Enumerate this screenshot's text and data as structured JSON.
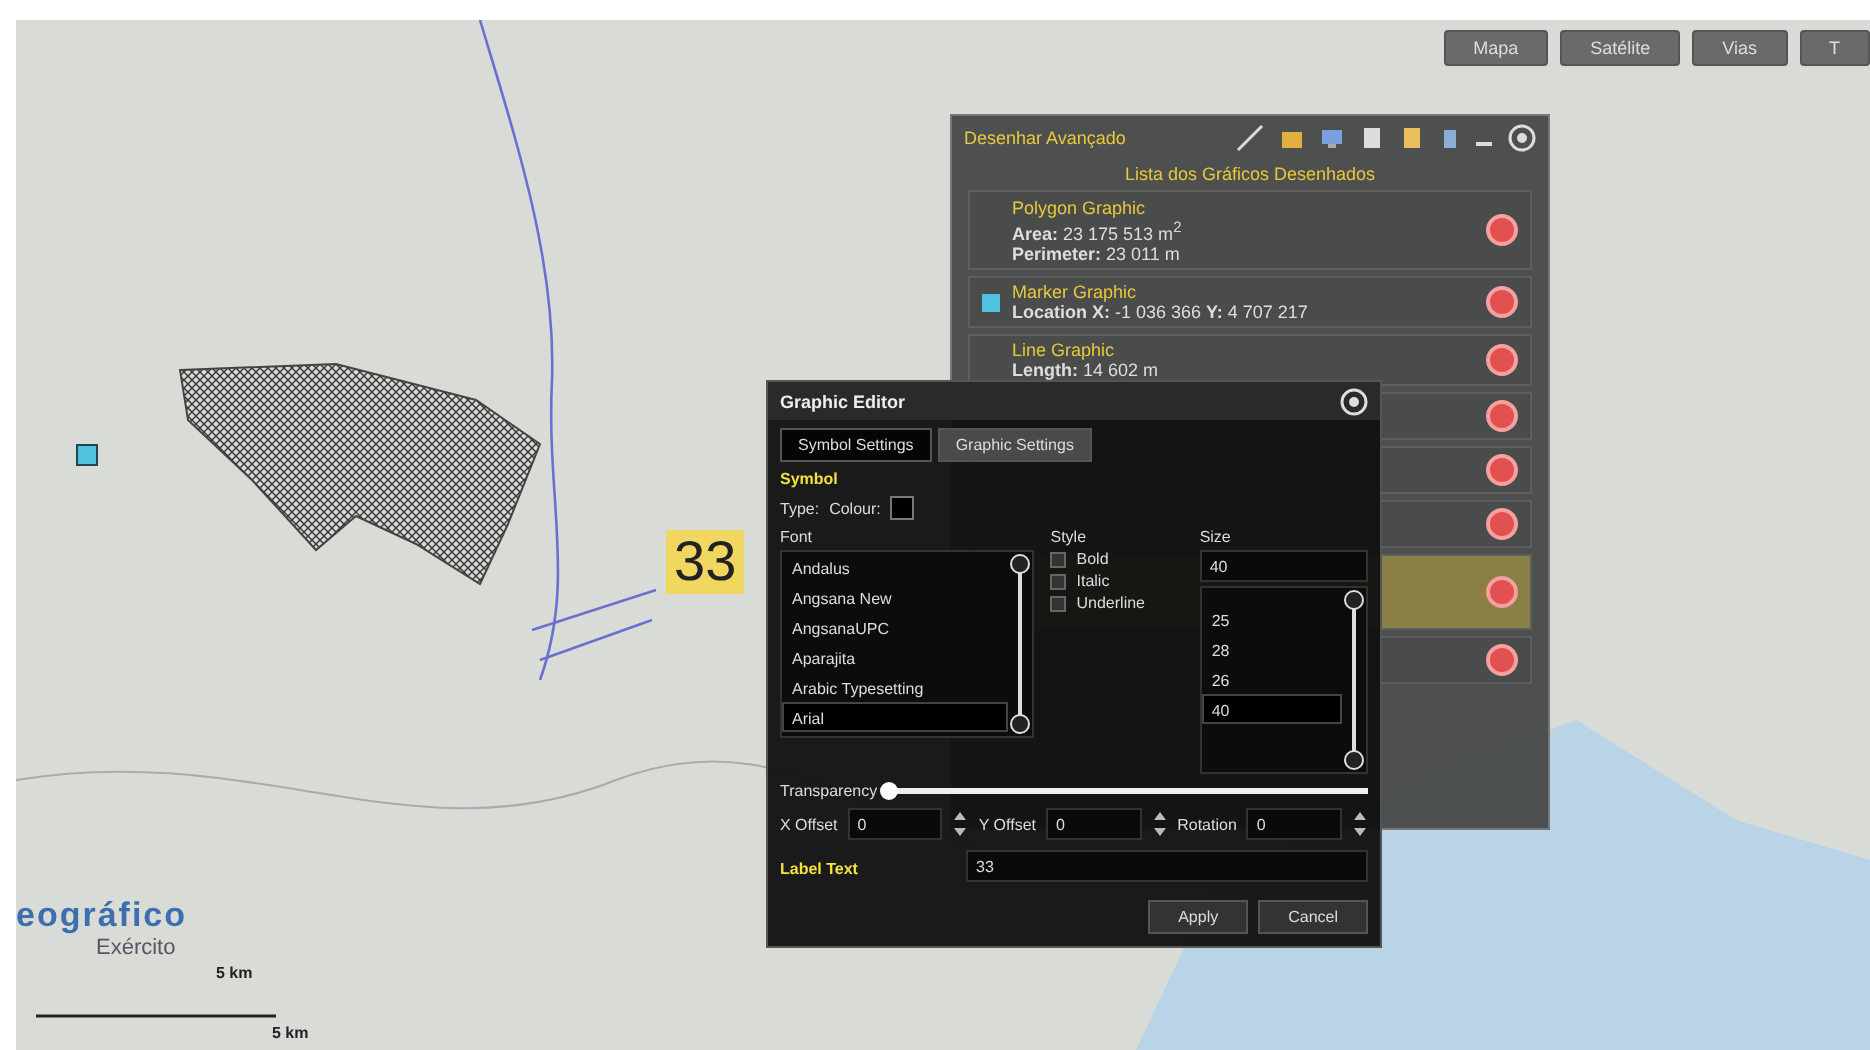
{
  "map_buttons": [
    {
      "label": "Mapa",
      "selected": false
    },
    {
      "label": "Satélite",
      "selected": false
    },
    {
      "label": "Vias",
      "selected": false
    },
    {
      "label": "T",
      "selected": false
    }
  ],
  "map_label": "33",
  "logo": {
    "line_1": "eográfico",
    "line_2": "Exército"
  },
  "scale": {
    "label_top": "5 km",
    "label_end": "5 km"
  },
  "drawn_panel": {
    "title": "Desenhar Avançado",
    "subtitle": "Lista dos Gráficos Desenhados",
    "items": [
      {
        "kind": "polygon",
        "title": "Polygon Graphic",
        "lines": [
          "**Area:** 23 175 513 m$^{2}$",
          "**Perimeter:** 23 011 m"
        ],
        "selected": false
      },
      {
        "kind": "marker",
        "title": "Marker Graphic",
        "color": "#4fc3e0",
        "lines": [
          "**Location X:** -1 036 366 **Y:** 4 707 217"
        ],
        "selected": false
      },
      {
        "kind": "line",
        "title": "Line Graphic",
        "lines": [
          "**Length:** 14 602 m"
        ],
        "selected": false
      },
      {
        "kind": "covered",
        "selected": false
      },
      {
        "kind": "covered",
        "selected": false
      },
      {
        "kind": "covered",
        "selected": false
      },
      {
        "kind": "covered",
        "selected": true
      },
      {
        "kind": "covered",
        "selected": false
      }
    ]
  },
  "graphic_editor": {
    "title": "Graphic Editor",
    "tabs": [
      {
        "label": "Symbol Settings",
        "selected": true
      },
      {
        "label": "Graphic Settings",
        "selected": false
      }
    ],
    "section": "Symbol",
    "type_label": "Type:",
    "colour_label": "Colour:",
    "colour_swatch": {
      "color": "#000000"
    },
    "font": {
      "label": "Font",
      "options": [
        {
          "label": "Andalus",
          "selected": false
        },
        {
          "label": "Angsana New",
          "selected": false
        },
        {
          "label": "AngsanaUPC",
          "selected": false
        },
        {
          "label": "Aparajita",
          "selected": false
        },
        {
          "label": "Arabic Typesetting",
          "selected": false
        },
        {
          "label": "Arial",
          "selected": true
        }
      ]
    },
    "style": {
      "label": "Style",
      "options": [
        {
          "label": "Bold",
          "checked": false
        },
        {
          "label": "Italic",
          "checked": false
        },
        {
          "label": "Underline",
          "checked": false
        }
      ]
    },
    "size": {
      "label": "Size",
      "value": "40",
      "options": [
        {
          "label": "25",
          "selected": false
        },
        {
          "label": "28",
          "selected": false
        },
        {
          "label": "26",
          "selected": false
        },
        {
          "label": "40",
          "selected": true
        }
      ]
    },
    "transparency": {
      "label": "Transparency",
      "level": 0
    },
    "offsets": [
      {
        "label": "X Offset",
        "value": "0"
      },
      {
        "label": "Y Offset",
        "value": "0"
      },
      {
        "label": "Rotation",
        "value": "0"
      }
    ],
    "label_text": {
      "label": "Label Text",
      "value": "33"
    },
    "buttons": [
      "Apply",
      "Cancel"
    ]
  }
}
